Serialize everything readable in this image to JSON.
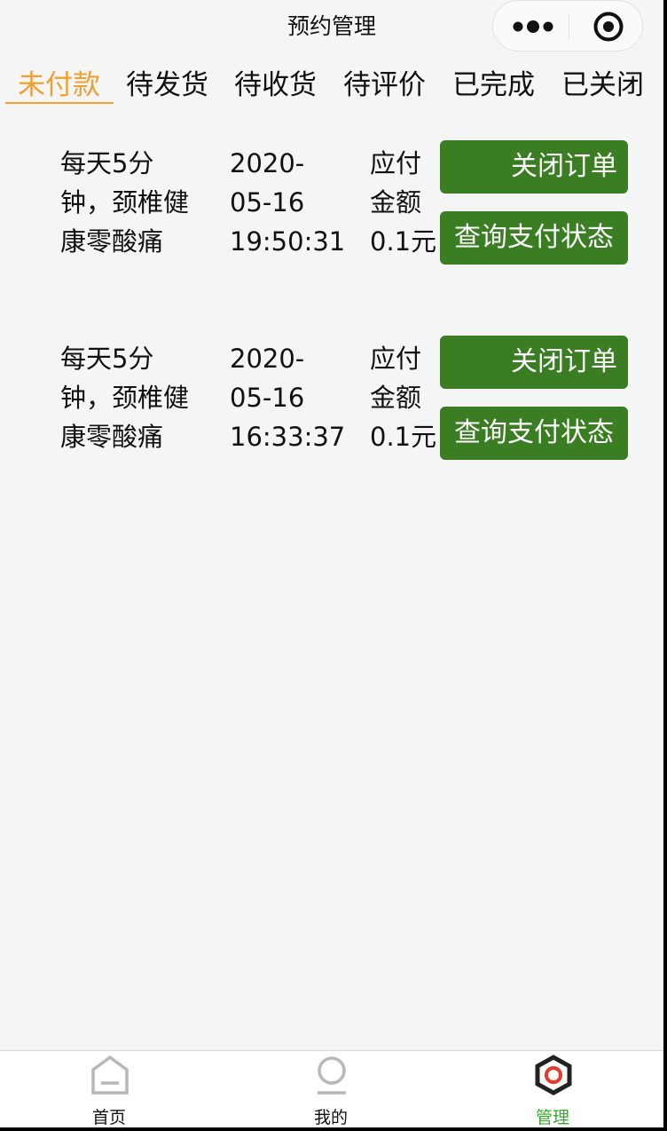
{
  "navbar": {
    "title": "预约管理"
  },
  "capsule": {
    "menu_icon": "more-dots-icon",
    "close_icon": "target-circle-icon"
  },
  "tabs": [
    {
      "label": "未付款",
      "active": true
    },
    {
      "label": "待发货",
      "active": false
    },
    {
      "label": "待收货",
      "active": false
    },
    {
      "label": "待评价",
      "active": false
    },
    {
      "label": "已完成",
      "active": false
    },
    {
      "label": "已关闭",
      "active": false
    }
  ],
  "orders": [
    {
      "name_lines": [
        "每天5分",
        "钟，颈椎健",
        "康零酸痛"
      ],
      "date_lines": [
        "2020-",
        "05-16",
        "19:50:31"
      ],
      "amount_lines": [
        "应付",
        "金额",
        "0.1元"
      ],
      "close_label": "关闭订单",
      "query_label": "查询支付状态"
    },
    {
      "name_lines": [
        "每天5分",
        "钟，颈椎健",
        "康零酸痛"
      ],
      "date_lines": [
        "2020-",
        "05-16",
        "16:33:37"
      ],
      "amount_lines": [
        "应付",
        "金额",
        "0.1元"
      ],
      "close_label": "关闭订单",
      "query_label": "查询支付状态"
    }
  ],
  "tabbar": {
    "items": [
      {
        "label": "首页",
        "icon": "home-icon",
        "active": false
      },
      {
        "label": "我的",
        "icon": "user-icon",
        "active": false
      },
      {
        "label": "管理",
        "icon": "manage-hexagon-icon",
        "active": true
      }
    ]
  },
  "colors": {
    "accent": "#f0a030",
    "button": "#3a7d22",
    "tabbar_active": "#3aa832",
    "background": "#f5f5f5"
  }
}
